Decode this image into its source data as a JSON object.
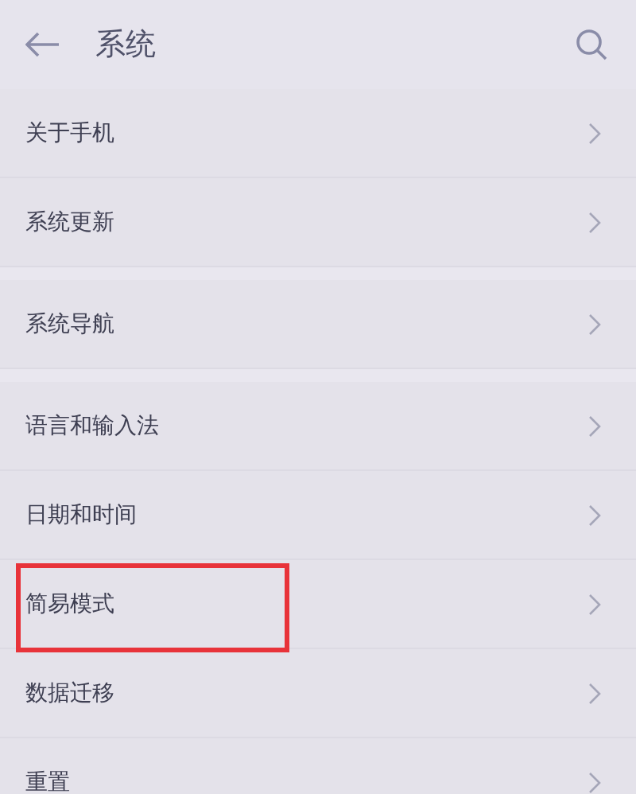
{
  "header": {
    "title": "系统"
  },
  "groups": [
    {
      "items": [
        {
          "label": "关于手机",
          "highlighted": false
        },
        {
          "label": "系统更新",
          "highlighted": false
        }
      ]
    },
    {
      "items": [
        {
          "label": "系统导航",
          "highlighted": false
        }
      ]
    },
    {
      "items": [
        {
          "label": "语言和输入法",
          "highlighted": false
        },
        {
          "label": "日期和时间",
          "highlighted": false
        },
        {
          "label": "简易模式",
          "highlighted": true
        },
        {
          "label": "数据迁移",
          "highlighted": false
        },
        {
          "label": "重置",
          "highlighted": false
        }
      ]
    }
  ]
}
